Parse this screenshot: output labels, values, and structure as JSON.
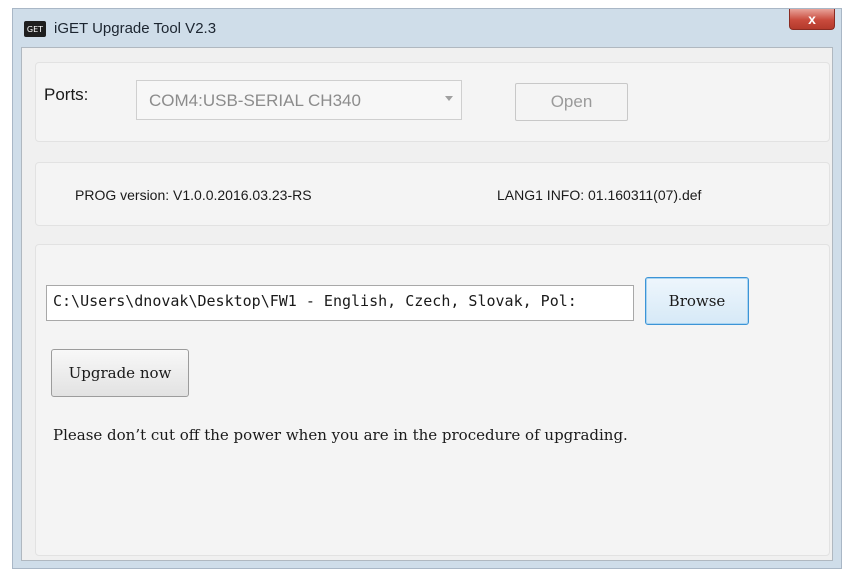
{
  "window": {
    "title": "iGET Upgrade Tool V2.3",
    "app_icon_text": "GET",
    "close_glyph": "x"
  },
  "ports": {
    "label": "Ports:",
    "selected": "COM4:USB-SERIAL CH340",
    "open_label": "Open"
  },
  "info": {
    "prog_version": "PROG version: V1.0.0.2016.03.23-RS",
    "lang_info": "LANG1 INFO: 01.160311(07).def"
  },
  "upgrade": {
    "path_value": "C:\\Users\\dnovak\\Desktop\\FW1 - English, Czech, Slovak, Pol:",
    "browse_label": "Browse",
    "upgrade_label": "Upgrade now",
    "warning": "Please don’t cut off the power when you are in the procedure of upgrading."
  },
  "colors": {
    "frame": "#cfdde9",
    "close_button": "#c94b3d",
    "browse_focus_border": "#3c94d6"
  },
  "icons": {
    "app": "iget-app-icon",
    "close": "close-icon",
    "dropdown": "chevron-down-icon"
  }
}
